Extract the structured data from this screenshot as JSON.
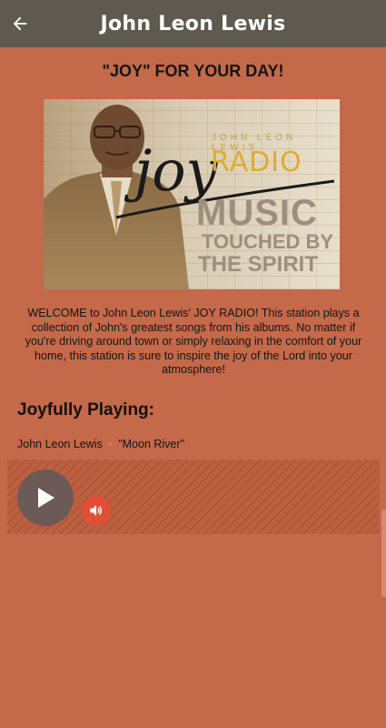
{
  "appbar": {
    "title": "John Leon Lewis",
    "back_icon": "arrow-left-icon"
  },
  "heading": "\"JOY\" FOR YOUR DAY!",
  "banner": {
    "name_text": "JOHN LEON LEWIS",
    "joy_text": "joy",
    "radio_text": "RADIO",
    "music_text": "MUSIC",
    "touched_text": "TOUCHED BY",
    "spirit_text": "THE SPIRIT"
  },
  "description": "WELCOME to John Leon Lewis' JOY RADIO! This station plays a collection of John's greatest songs from his albums. No matter if you're driving around town or simply relaxing in the comfort of your home, this station is sure to inspire the joy of the Lord into your atmosphere!",
  "now_playing": {
    "label": "Joyfully Playing:",
    "artist": "John Leon Lewis",
    "separator": "•",
    "song": "\"Moon River\""
  },
  "player": {
    "play_icon": "play-icon",
    "volume_icon": "volume-icon"
  },
  "colors": {
    "background": "#c4694a",
    "appbar": "#5e5a50",
    "volume_button": "#e24e35",
    "play_button": "#6b5a55"
  }
}
